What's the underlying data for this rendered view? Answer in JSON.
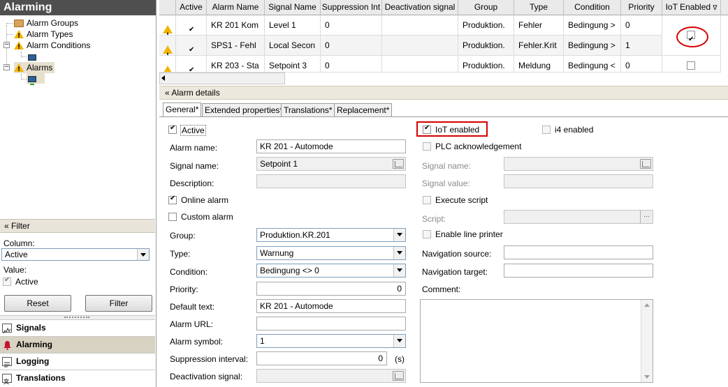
{
  "app": {
    "title": "Alarming"
  },
  "tree": {
    "items": [
      {
        "label": "Alarm Groups"
      },
      {
        "label": "Alarm Types"
      },
      {
        "label": "Alarm Conditions"
      },
      {
        "label": "Alarms"
      }
    ]
  },
  "filter": {
    "header": "Filter",
    "column_label": "Column:",
    "column_value": "Active",
    "value_label": "Value:",
    "value_check_label": "Active",
    "value_checked": true,
    "reset_label": "Reset",
    "filter_label": "Filter"
  },
  "nav": {
    "items": [
      {
        "label": "Signals",
        "selected": false
      },
      {
        "label": "Alarming",
        "selected": true
      },
      {
        "label": "Logging",
        "selected": false
      },
      {
        "label": "Translations",
        "selected": false
      }
    ]
  },
  "grid": {
    "columns": [
      "Active",
      "Alarm Name",
      "Signal Name",
      "Suppression Int",
      "Deactivation signal",
      "Group",
      "Type",
      "Condition",
      "Priority",
      "IoT Enabled"
    ],
    "rows": [
      {
        "active": true,
        "name": "KR 201 Kom",
        "signal": "Level 1",
        "suppression": "0",
        "deactivation": "",
        "group": "Produktion.",
        "type": "Fehler",
        "condition": "Bedingung >",
        "priority": "0",
        "iot": true
      },
      {
        "active": true,
        "name": "SPS1 - Fehl",
        "signal": "Local Secon",
        "suppression": "0",
        "deactivation": "",
        "group": "Produktion.",
        "type": "Fehler.Krit",
        "condition": "Bedingung >",
        "priority": "1",
        "iot": false
      },
      {
        "active": true,
        "name": "KR 203 - Sta",
        "signal": "Setpoint 3",
        "suppression": "0",
        "deactivation": "",
        "group": "Produktion.",
        "type": "Meldung",
        "condition": "Bedingung <",
        "priority": "0",
        "iot": false
      }
    ]
  },
  "details": {
    "header": "Alarm details",
    "tabs": [
      "General*",
      "Extended properties*",
      "Translations*",
      "Replacement*"
    ],
    "left": {
      "active_label": "Active",
      "active_checked": true,
      "alarm_name_label": "Alarm name:",
      "alarm_name_value": "KR 201 - Automode",
      "signal_name_label": "Signal name:",
      "signal_name_value": "Setpoint 1",
      "description_label": "Description:",
      "description_value": "",
      "online_alarm_label": "Online alarm",
      "online_alarm_checked": true,
      "custom_alarm_label": "Custom alarm",
      "custom_alarm_checked": false,
      "group_label": "Group:",
      "group_value": "Produktion.KR.201",
      "type_label": "Type:",
      "type_value": "Warnung",
      "condition_label": "Condition:",
      "condition_value": "Bedingung <> 0",
      "priority_label": "Priority:",
      "priority_value": "0",
      "default_text_label": "Default text:",
      "default_text_value": "KR 201 - Automode",
      "alarm_url_label": "Alarm URL:",
      "alarm_url_value": "",
      "alarm_symbol_label": "Alarm symbol:",
      "alarm_symbol_value": "1",
      "suppression_label": "Suppression interval:",
      "suppression_value": "0",
      "suppression_unit": "(s)",
      "deactivation_label": "Deactivation signal:",
      "deactivation_value": ""
    },
    "right": {
      "iot_label": "IoT enabled",
      "iot_checked": true,
      "i4_label": "i4 enabled",
      "i4_checked": false,
      "plc_ack_label": "PLC acknowledgement",
      "plc_ack_checked": false,
      "signal_name_label": "Signal name:",
      "signal_value_label": "Signal value:",
      "execute_script_label": "Execute script",
      "execute_script_checked": false,
      "script_label": "Script:",
      "line_printer_label": "Enable line printer",
      "line_printer_checked": false,
      "nav_source_label": "Navigation source:",
      "nav_target_label": "Navigation target:",
      "comment_label": "Comment:"
    }
  },
  "colors": {
    "title_bar": "#4f4f4f",
    "highlight": "#d40000",
    "warning": "#f3b400",
    "selected_nav": "#d8d2c2"
  }
}
